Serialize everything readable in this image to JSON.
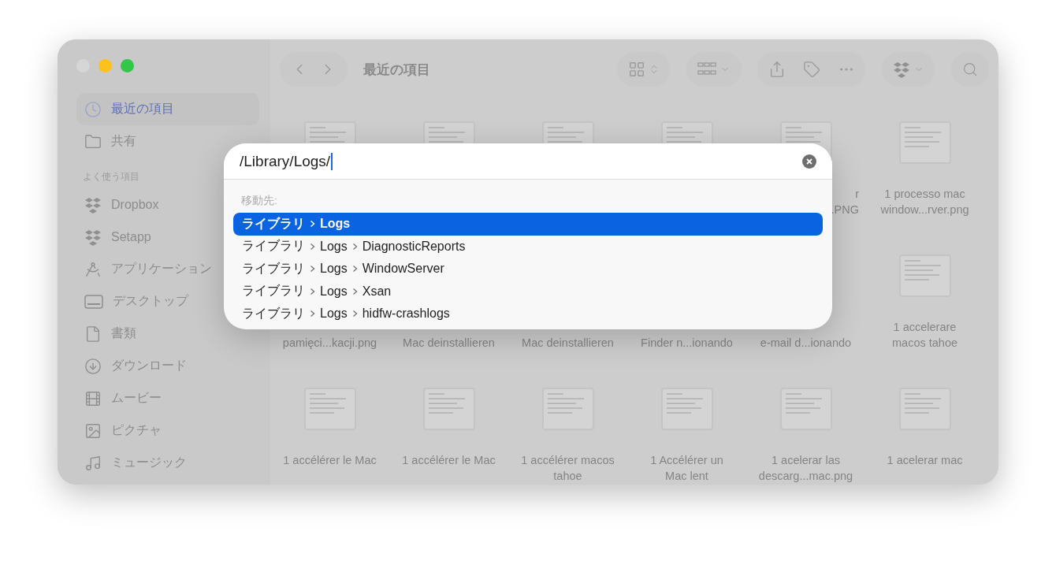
{
  "toolbar": {
    "title": "最近の項目"
  },
  "sidebar": {
    "items": [
      {
        "label": "最近の項目",
        "kind": "recent",
        "selected": true
      },
      {
        "label": "共有",
        "kind": "shared",
        "selected": false
      }
    ],
    "section": {
      "title": "よく使う項目",
      "items": [
        {
          "label": "Dropbox",
          "kind": "dropbox",
          "selected": false
        },
        {
          "label": "Setapp",
          "kind": "setapp",
          "selected": false
        },
        {
          "label": "アプリケーション",
          "kind": "apps",
          "selected": false
        },
        {
          "label": "デスクトップ",
          "kind": "desktop",
          "selected": false
        },
        {
          "label": "書類",
          "kind": "documents",
          "selected": false
        },
        {
          "label": "ダウンロード",
          "kind": "downloads",
          "selected": false
        },
        {
          "label": "ムービー",
          "kind": "movies",
          "selected": false
        },
        {
          "label": "ピクチャ",
          "kind": "pictures",
          "selected": false
        },
        {
          "label": "ミュージック",
          "kind": "music",
          "selected": false
        }
      ]
    }
  },
  "files": [
    {
      "kind": "file"
    },
    {
      "kind": "file"
    },
    {
      "kind": "file"
    },
    {
      "kind": "file"
    },
    {
      "kind": "partial",
      "lines": [
        "r",
        ".PNG"
      ]
    },
    {
      "kind": "file",
      "lines": [
        "1  processo mac",
        "window...rver.png"
      ]
    },
    {
      "kind": "covered",
      "lines": [
        "pamięci...kacji.png"
      ]
    },
    {
      "kind": "covered",
      "lines": [
        "Mac deinstallieren"
      ]
    },
    {
      "kind": "covered",
      "lines": [
        "Mac deinstallieren"
      ]
    },
    {
      "kind": "covered",
      "lines": [
        "Finder n...ionando"
      ]
    },
    {
      "kind": "covered",
      "lines": [
        "e-mail d...ionando"
      ]
    },
    {
      "kind": "file",
      "lines": [
        "1 accelerare",
        "macos tahoe"
      ]
    },
    {
      "kind": "file",
      "lines": [
        "1 accélérer le Mac"
      ]
    },
    {
      "kind": "file",
      "lines": [
        "1 accélérer le Mac"
      ]
    },
    {
      "kind": "file",
      "lines": [
        "1 accélérer macos",
        "tahoe"
      ]
    },
    {
      "kind": "file",
      "lines": [
        "1 Accélérer un",
        "Mac lent"
      ]
    },
    {
      "kind": "file",
      "lines": [
        "1 acelerar las",
        "descarg...mac.png"
      ]
    },
    {
      "kind": "file",
      "lines": [
        "1 acelerar mac"
      ]
    }
  ],
  "go_to_dialog": {
    "path": "/Library/Logs/",
    "heading": "移動先:",
    "results": [
      {
        "segments": [
          "ライブラリ",
          "Logs"
        ],
        "selected": true
      },
      {
        "segments": [
          "ライブラリ",
          "Logs",
          "DiagnosticReports"
        ],
        "selected": false
      },
      {
        "segments": [
          "ライブラリ",
          "Logs",
          "WindowServer"
        ],
        "selected": false
      },
      {
        "segments": [
          "ライブラリ",
          "Logs",
          "Xsan"
        ],
        "selected": false
      },
      {
        "segments": [
          "ライブラリ",
          "Logs",
          "hidfw-crashlogs"
        ],
        "selected": false
      }
    ]
  }
}
